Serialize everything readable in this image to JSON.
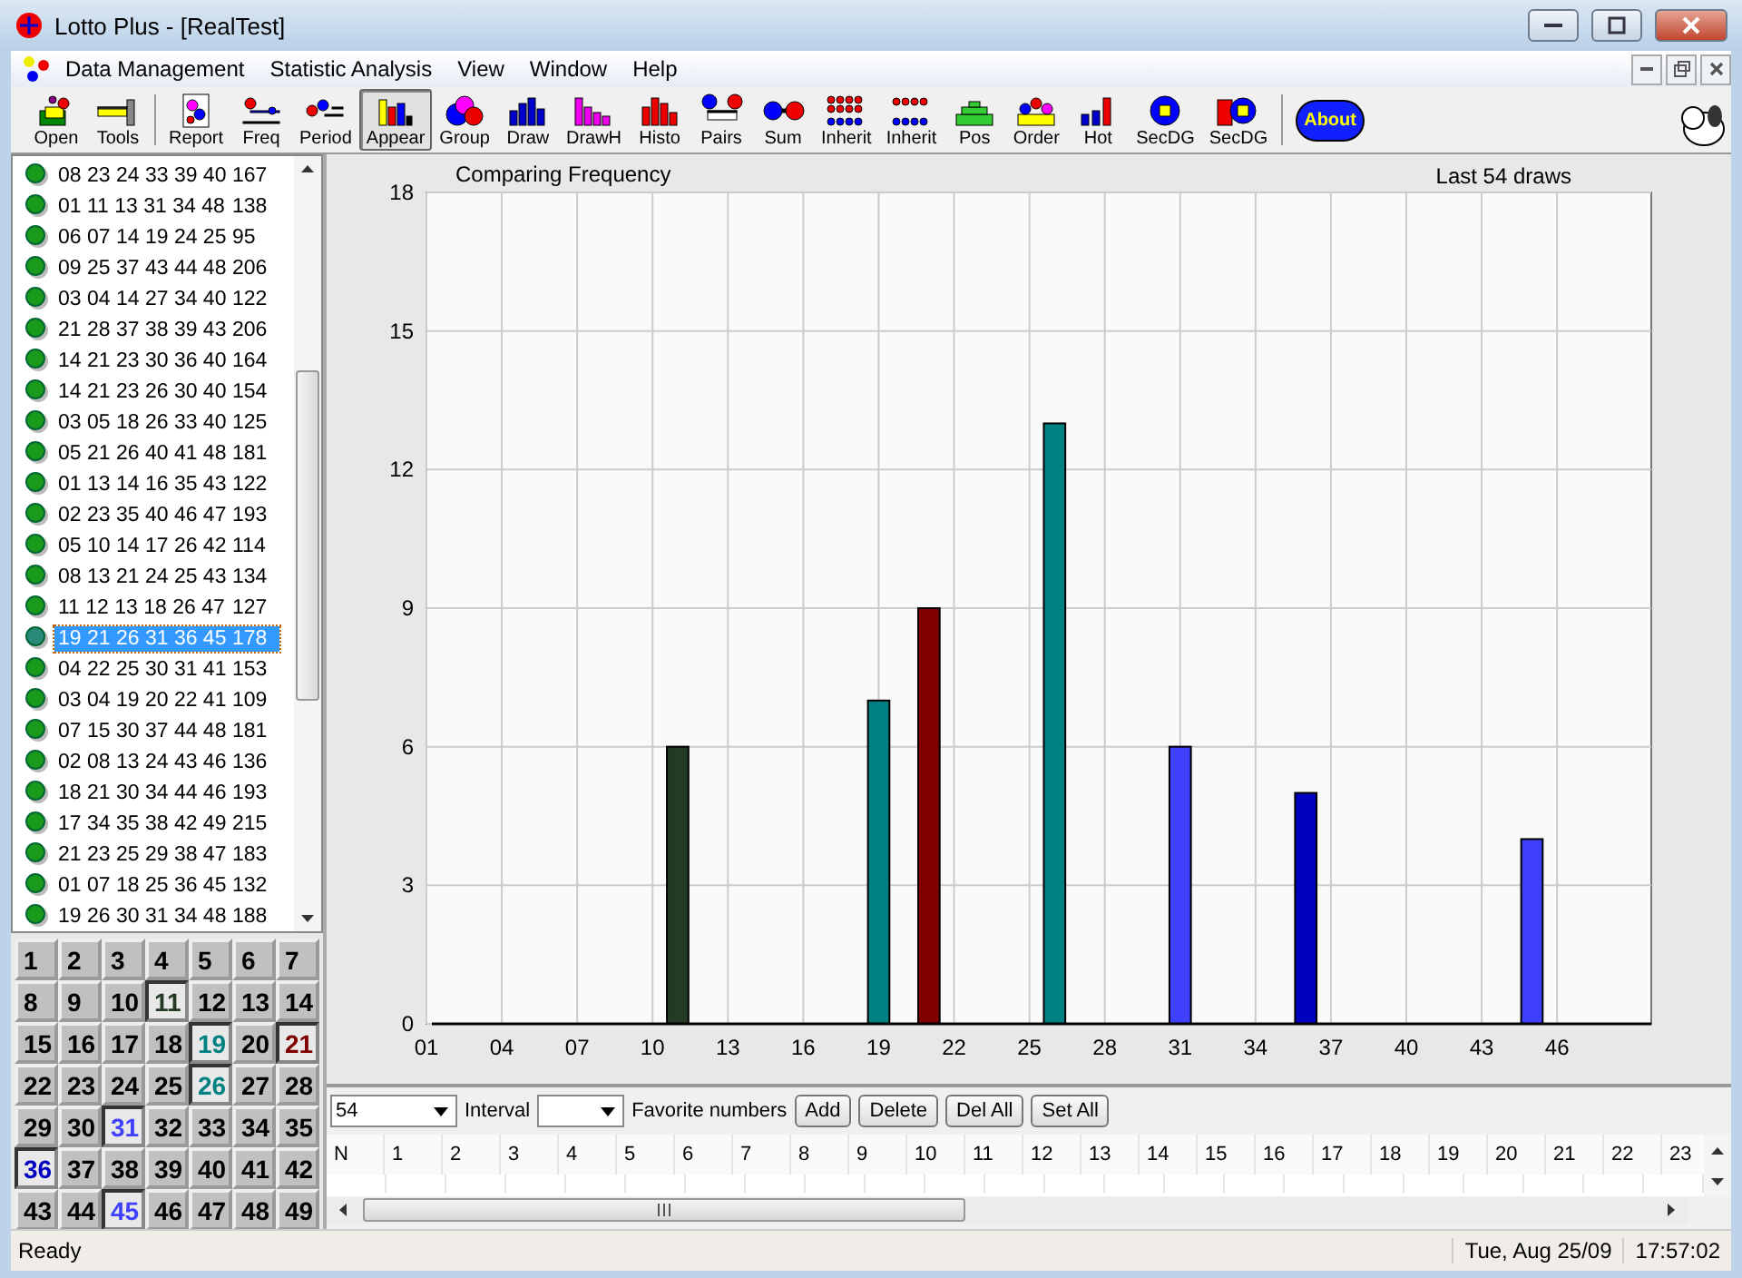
{
  "window": {
    "title": "Lotto Plus - [RealTest]"
  },
  "menu": [
    {
      "label": "Data Management"
    },
    {
      "label": "Statistic Analysis"
    },
    {
      "label": "View"
    },
    {
      "label": "Window"
    },
    {
      "label": "Help"
    }
  ],
  "toolbar": [
    {
      "label": "Open",
      "selected": false
    },
    {
      "label": "Tools",
      "selected": false
    },
    {
      "label": "Report",
      "selected": false
    },
    {
      "label": "Freq",
      "selected": false
    },
    {
      "label": "Period",
      "selected": false
    },
    {
      "label": "Appear",
      "selected": true
    },
    {
      "label": "Group",
      "selected": false
    },
    {
      "label": "Draw",
      "selected": false
    },
    {
      "label": "DrawH",
      "selected": false
    },
    {
      "label": "Histo",
      "selected": false
    },
    {
      "label": "Pairs",
      "selected": false
    },
    {
      "label": "Sum",
      "selected": false
    },
    {
      "label": "Inherit",
      "selected": false
    },
    {
      "label": "Inherit",
      "selected": false
    },
    {
      "label": "Pos",
      "selected": false
    },
    {
      "label": "Order",
      "selected": false
    },
    {
      "label": "Hot",
      "selected": false
    },
    {
      "label": "SecDG",
      "selected": false
    },
    {
      "label": "SecDG",
      "selected": false
    }
  ],
  "about_button": {
    "label": "About"
  },
  "draws": [
    {
      "numbers": "08 23 24 33 39 40",
      "sum": "167",
      "selected": false
    },
    {
      "numbers": "01 11 13 31 34 48",
      "sum": "138",
      "selected": false
    },
    {
      "numbers": "06 07 14 19 24 25",
      "sum": "95",
      "selected": false
    },
    {
      "numbers": "09 25 37 43 44 48",
      "sum": "206",
      "selected": false
    },
    {
      "numbers": "03 04 14 27 34 40",
      "sum": "122",
      "selected": false
    },
    {
      "numbers": "21 28 37 38 39 43",
      "sum": "206",
      "selected": false
    },
    {
      "numbers": "14 21 23 30 36 40",
      "sum": "164",
      "selected": false
    },
    {
      "numbers": "14 21 23 26 30 40",
      "sum": "154",
      "selected": false
    },
    {
      "numbers": "03 05 18 26 33 40",
      "sum": "125",
      "selected": false
    },
    {
      "numbers": "05 21 26 40 41 48",
      "sum": "181",
      "selected": false
    },
    {
      "numbers": "01 13 14 16 35 43",
      "sum": "122",
      "selected": false
    },
    {
      "numbers": "02 23 35 40 46 47",
      "sum": "193",
      "selected": false
    },
    {
      "numbers": "05 10 14 17 26 42",
      "sum": "114",
      "selected": false
    },
    {
      "numbers": "08 13 21 24 25 43",
      "sum": "134",
      "selected": false
    },
    {
      "numbers": "11 12 13 18 26 47",
      "sum": "127",
      "selected": false
    },
    {
      "numbers": "19 21 26 31 36 45",
      "sum": "178",
      "selected": true
    },
    {
      "numbers": "04 22 25 30 31 41",
      "sum": "153",
      "selected": false
    },
    {
      "numbers": "03 04 19 20 22 41",
      "sum": "109",
      "selected": false
    },
    {
      "numbers": "07 15 30 37 44 48",
      "sum": "181",
      "selected": false
    },
    {
      "numbers": "02 08 13 24 43 46",
      "sum": "136",
      "selected": false
    },
    {
      "numbers": "18 21 30 34 44 46",
      "sum": "193",
      "selected": false
    },
    {
      "numbers": "17 34 35 38 42 49",
      "sum": "215",
      "selected": false
    },
    {
      "numbers": "21 23 25 29 38 47",
      "sum": "183",
      "selected": false
    },
    {
      "numbers": "01 07 18 25 36 45",
      "sum": "132",
      "selected": false
    },
    {
      "numbers": "19 26 30 31 34 48",
      "sum": "188",
      "selected": false
    }
  ],
  "number_grid": [
    {
      "label": "1",
      "selected": false
    },
    {
      "label": "2",
      "selected": false
    },
    {
      "label": "3",
      "selected": false
    },
    {
      "label": "4",
      "selected": false
    },
    {
      "label": "5",
      "selected": false
    },
    {
      "label": "6",
      "selected": false
    },
    {
      "label": "7",
      "selected": false
    },
    {
      "label": "8",
      "selected": false
    },
    {
      "label": "9",
      "selected": false
    },
    {
      "label": "10",
      "selected": false
    },
    {
      "label": "11",
      "selected": true,
      "color": "#253a25"
    },
    {
      "label": "12",
      "selected": false
    },
    {
      "label": "13",
      "selected": false
    },
    {
      "label": "14",
      "selected": false
    },
    {
      "label": "15",
      "selected": false
    },
    {
      "label": "16",
      "selected": false
    },
    {
      "label": "17",
      "selected": false
    },
    {
      "label": "18",
      "selected": false
    },
    {
      "label": "19",
      "selected": true,
      "color": "#008080"
    },
    {
      "label": "20",
      "selected": false
    },
    {
      "label": "21",
      "selected": true,
      "color": "#800000"
    },
    {
      "label": "22",
      "selected": false
    },
    {
      "label": "23",
      "selected": false
    },
    {
      "label": "24",
      "selected": false
    },
    {
      "label": "25",
      "selected": false
    },
    {
      "label": "26",
      "selected": true,
      "color": "#008080"
    },
    {
      "label": "27",
      "selected": false
    },
    {
      "label": "28",
      "selected": false
    },
    {
      "label": "29",
      "selected": false
    },
    {
      "label": "30",
      "selected": false
    },
    {
      "label": "31",
      "selected": true,
      "color": "#4040ff"
    },
    {
      "label": "32",
      "selected": false
    },
    {
      "label": "33",
      "selected": false
    },
    {
      "label": "34",
      "selected": false
    },
    {
      "label": "35",
      "selected": false
    },
    {
      "label": "36",
      "selected": true,
      "color": "#0000c0"
    },
    {
      "label": "37",
      "selected": false
    },
    {
      "label": "38",
      "selected": false
    },
    {
      "label": "39",
      "selected": false
    },
    {
      "label": "40",
      "selected": false
    },
    {
      "label": "41",
      "selected": false
    },
    {
      "label": "42",
      "selected": false
    },
    {
      "label": "43",
      "selected": false
    },
    {
      "label": "44",
      "selected": false
    },
    {
      "label": "45",
      "selected": true,
      "color": "#4040ff"
    },
    {
      "label": "46",
      "selected": false
    },
    {
      "label": "47",
      "selected": false
    },
    {
      "label": "48",
      "selected": false
    },
    {
      "label": "49",
      "selected": false
    }
  ],
  "chart": {
    "subtitle": "Last 54 draws",
    "chart_data": {
      "type": "bar",
      "title": "Comparing Frequency",
      "grid": true,
      "x": [
        11,
        19,
        21,
        26,
        31,
        36,
        45
      ],
      "values": [
        6,
        7,
        9,
        13,
        6,
        5,
        4
      ],
      "xlim": [
        1,
        49.75
      ],
      "ylim": [
        0,
        18
      ],
      "yticks": [
        0,
        3,
        6,
        9,
        12,
        15,
        18
      ],
      "xticks": [
        {
          "value": 1,
          "label": "01"
        },
        {
          "value": 4,
          "label": "04"
        },
        {
          "value": 7,
          "label": "07"
        },
        {
          "value": 10,
          "label": "10"
        },
        {
          "value": 13,
          "label": "13"
        },
        {
          "value": 16,
          "label": "16"
        },
        {
          "value": 19,
          "label": "19"
        },
        {
          "value": 22,
          "label": "22"
        },
        {
          "value": 25,
          "label": "25"
        },
        {
          "value": 28,
          "label": "28"
        },
        {
          "value": 31,
          "label": "31"
        },
        {
          "value": 34,
          "label": "34"
        },
        {
          "value": 37,
          "label": "37"
        },
        {
          "value": 40,
          "label": "40"
        },
        {
          "value": 43,
          "label": "43"
        },
        {
          "value": 46,
          "label": "46"
        }
      ]
    }
  },
  "controls": {
    "draws_select": "54",
    "interval_label": "Interval",
    "favorites_label": "Favorite numbers",
    "buttons": [
      "Add",
      "Delete",
      "Del All",
      "Set All"
    ]
  },
  "table": {
    "columns": [
      "N",
      "1",
      "2",
      "3",
      "4",
      "5",
      "6",
      "7",
      "8",
      "9",
      "10",
      "11",
      "12",
      "13",
      "14",
      "15",
      "16",
      "17",
      "18",
      "19",
      "20",
      "21",
      "22",
      "23"
    ]
  },
  "status_bar": {
    "message": "Ready",
    "date": "Tue, Aug 25/09",
    "time": "17:57:02"
  }
}
